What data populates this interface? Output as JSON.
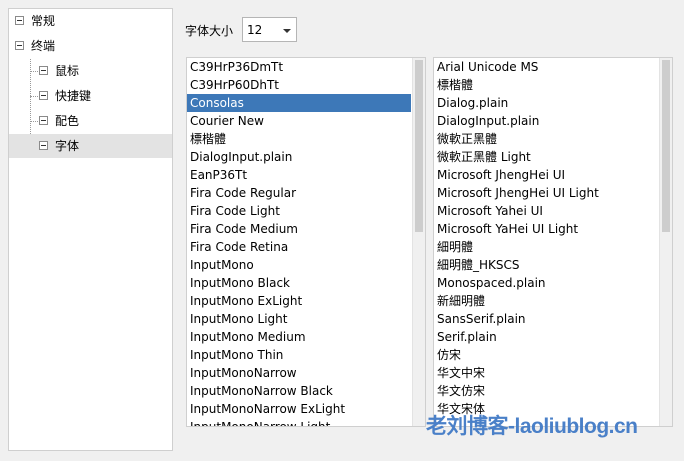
{
  "tree": {
    "items": [
      {
        "label": "常规"
      },
      {
        "label": "终端"
      },
      {
        "label": "鼠标"
      },
      {
        "label": "快捷键"
      },
      {
        "label": "配色"
      },
      {
        "label": "字体"
      }
    ]
  },
  "font_size": {
    "label": "字体大小",
    "value": "12"
  },
  "font_list_left": [
    "C39HrP36DmTt",
    "C39HrP60DhTt",
    "Consolas",
    "Courier New",
    "標楷體",
    "DialogInput.plain",
    "EanP36Tt",
    "Fira Code Regular",
    "Fira Code Light",
    "Fira Code Medium",
    "Fira Code Retina",
    "InputMono",
    "InputMono Black",
    "InputMono ExLight",
    "InputMono Light",
    "InputMono Medium",
    "InputMono Thin",
    "InputMonoNarrow",
    "InputMonoNarrow Black",
    "InputMonoNarrow ExLight",
    "InputMonoNarrow Light"
  ],
  "font_list_left_selected": "Consolas",
  "font_list_right": [
    "Arial Unicode MS",
    "標楷體",
    "Dialog.plain",
    "DialogInput.plain",
    "微軟正黑體",
    "微軟正黑體 Light",
    "Microsoft JhengHei UI",
    "Microsoft JhengHei UI Light",
    "Microsoft Yahei UI",
    "Microsoft YaHei UI Light",
    "細明體",
    "細明體_HKSCS",
    "Monospaced.plain",
    "新細明體",
    "SansSerif.plain",
    "Serif.plain",
    "仿宋",
    "华文中宋",
    "华文仿宋",
    "华文宋体"
  ],
  "watermark": "老刘博客-laoliublog.cn"
}
